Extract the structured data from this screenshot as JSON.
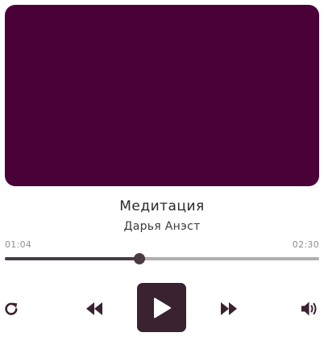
{
  "player": {
    "cover": {
      "color": "#4a0138"
    },
    "track": {
      "title": "Медитация",
      "artist": "Дарья Анэст"
    },
    "progress": {
      "elapsed": "01:04",
      "total": "02:30",
      "fraction": 0.427
    },
    "controls": {
      "repeat_icon": "repeat-icon",
      "rewind_icon": "rewind-icon",
      "play_icon": "play-icon",
      "forward_icon": "fast-forward-icon",
      "volume_icon": "volume-icon"
    },
    "colors": {
      "accent": "#3b2230",
      "track_fill": "#4a3a44",
      "track_bg": "#b3acb1"
    }
  }
}
